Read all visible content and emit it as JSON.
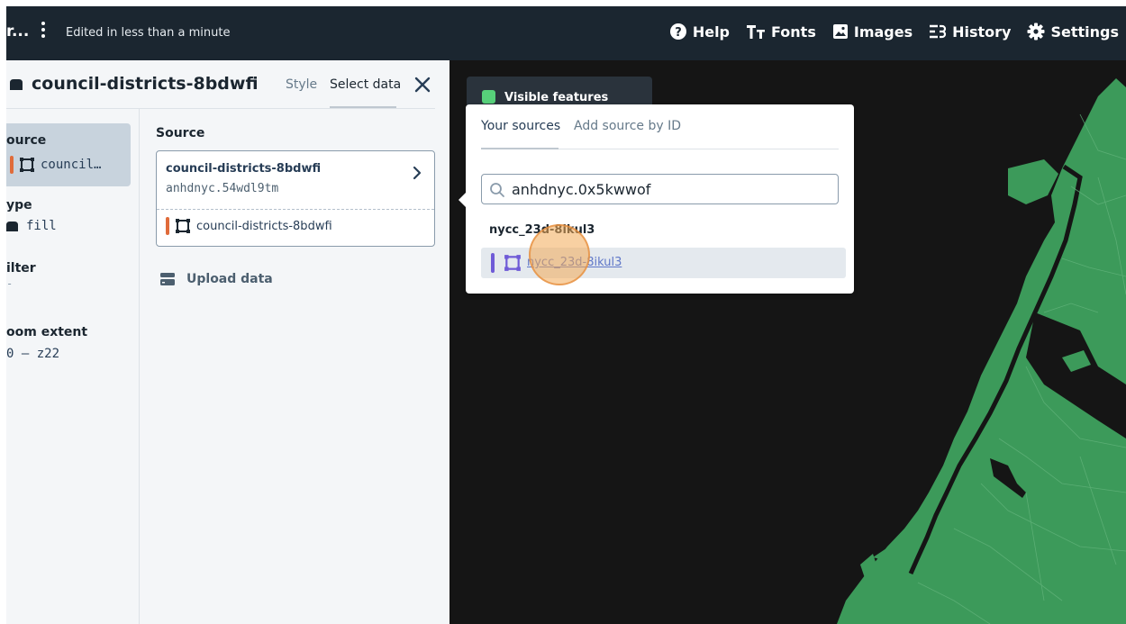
{
  "topbar": {
    "title_fragment": "r...",
    "edited_status": "Edited in less than a minute",
    "nav": [
      {
        "label": "Help",
        "icon": "help-icon"
      },
      {
        "label": "Fonts",
        "icon": "fonts-icon"
      },
      {
        "label": "Images",
        "icon": "images-icon"
      },
      {
        "label": "History",
        "icon": "history-icon"
      },
      {
        "label": "Settings",
        "icon": "settings-icon"
      }
    ]
  },
  "panel": {
    "layer_name": "council-districts-8bdwfi",
    "tabs": [
      "Style",
      "Select data"
    ],
    "active_tab": "Select data",
    "properties": {
      "source_label": "ource",
      "source_value": "council…",
      "type_label": "ype",
      "type_value": "fill",
      "filter_label": "ilter",
      "filter_value": "-",
      "zoom_label": "oom extent",
      "zoom_value": "0 – z22"
    },
    "source": {
      "heading": "Source",
      "tileset_name": "council-districts-8bdwfi",
      "tileset_id": "anhdnyc.54wdl9tm",
      "layer_name": "council-districts-8bdwfi"
    },
    "upload_label": "Upload data"
  },
  "map": {
    "visible_features_label": "Visible features",
    "land_color": "#3c9a5a",
    "water_color": "#151515"
  },
  "popover": {
    "tabs": [
      "Your sources",
      "Add source by ID"
    ],
    "active_tab": "Your sources",
    "search_value": "anhdnyc.0x5kwwof",
    "group_title": "nycc_23d-8ikul3",
    "result_layer": "nycc_23d-8ikul3"
  },
  "colors": {
    "topbar_bg": "#1b2630",
    "accent_orange": "#e06b3a",
    "accent_purple": "#6f5bd7",
    "visible_green": "#57d07a"
  }
}
